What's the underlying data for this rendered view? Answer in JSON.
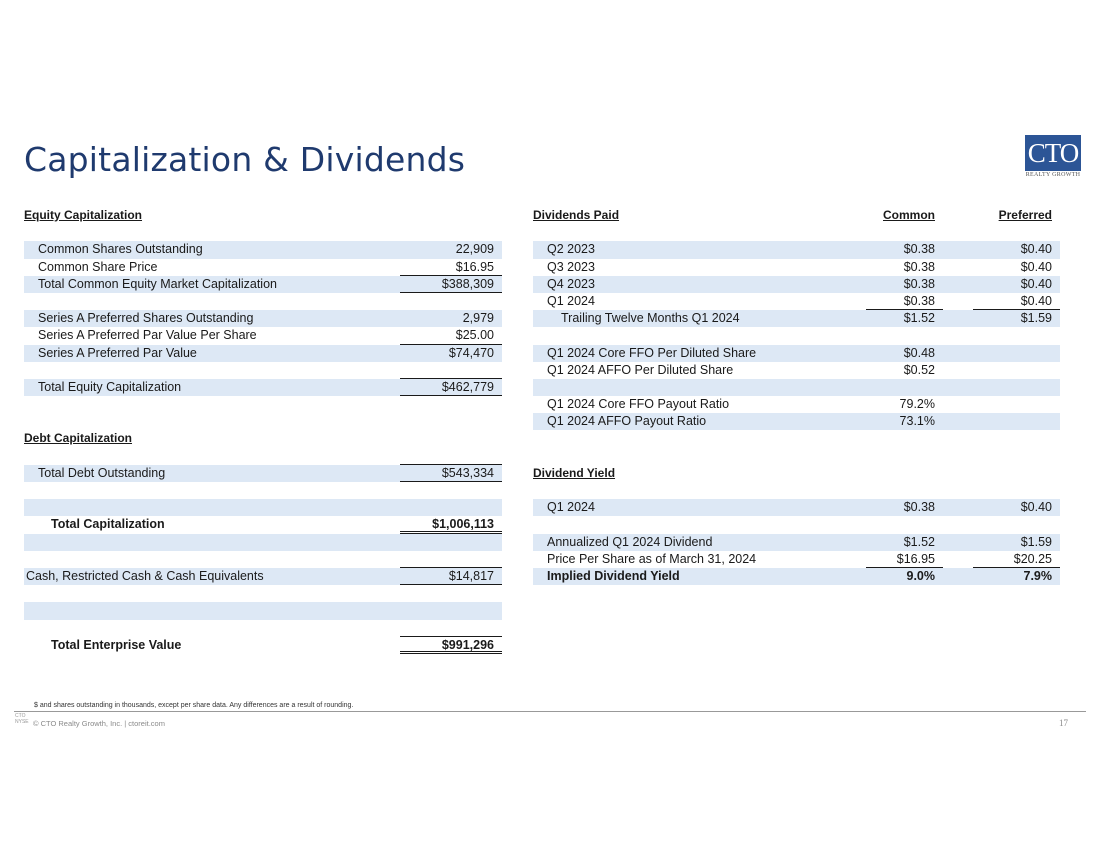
{
  "title": "Capitalization & Dividends",
  "logo": {
    "main": "CTO",
    "sub": "REALTY GROWTH"
  },
  "equity": {
    "header": "Equity Capitalization",
    "rows": [
      {
        "label": "Common Shares Outstanding",
        "value": "22,909"
      },
      {
        "label": "Common Share Price",
        "value": "$16.95"
      },
      {
        "label": "Total Common Equity Market Capitalization",
        "value": "$388,309"
      },
      {
        "label": "Series A Preferred Shares Outstanding",
        "value": "2,979"
      },
      {
        "label": "Series A Preferred Par Value Per Share",
        "value": "$25.00"
      },
      {
        "label": "Series A Preferred Par Value",
        "value": "$74,470"
      },
      {
        "label": "Total Equity Capitalization",
        "value": "$462,779"
      }
    ]
  },
  "debt": {
    "header": "Debt Capitalization",
    "total_debt": {
      "label": "Total Debt Outstanding",
      "value": "$543,334"
    },
    "total_cap": {
      "label": "Total Capitalization",
      "value": "$1,006,113"
    },
    "cash": {
      "label": "Cash, Restricted Cash & Cash Equivalents",
      "value": "$14,817"
    },
    "tev": {
      "label": "Total Enterprise Value",
      "value": "$991,296"
    }
  },
  "dividends": {
    "header": "Dividends Paid",
    "col_common": "Common",
    "col_preferred": "Preferred",
    "rows": [
      {
        "label": "Q2 2023",
        "common": "$0.38",
        "preferred": "$0.40"
      },
      {
        "label": "Q3 2023",
        "common": "$0.38",
        "preferred": "$0.40"
      },
      {
        "label": "Q4 2023",
        "common": "$0.38",
        "preferred": "$0.40"
      },
      {
        "label": "Q1 2024",
        "common": "$0.38",
        "preferred": "$0.40"
      },
      {
        "label": "Trailing Twelve Months Q1 2024",
        "common": "$1.52",
        "preferred": "$1.59"
      }
    ],
    "ffo": [
      {
        "label": "Q1 2024 Core FFO Per Diluted Share",
        "common": "$0.48"
      },
      {
        "label": "Q1 2024 AFFO Per Diluted Share",
        "common": "$0.52"
      }
    ],
    "payout": [
      {
        "label": "Q1 2024 Core FFO Payout Ratio",
        "common": "79.2%"
      },
      {
        "label": "Q1 2024 AFFO Payout Ratio",
        "common": "73.1%"
      }
    ]
  },
  "yield": {
    "header": "Dividend Yield",
    "q1": {
      "label": "Q1 2024",
      "common": "$0.38",
      "preferred": "$0.40"
    },
    "annualized": {
      "label": "Annualized Q1 2024 Dividend",
      "common": "$1.52",
      "preferred": "$1.59"
    },
    "price": {
      "label": "Price Per Share as of March 31, 2024",
      "common": "$16.95",
      "preferred": "$20.25"
    },
    "implied": {
      "label": "Implied Dividend Yield",
      "common": "9.0%",
      "preferred": "7.9%"
    }
  },
  "footnote": "$ and shares outstanding in thousands, except per share data. Any differences are a result of rounding.",
  "footer": {
    "logo_text": "CTO NYSE",
    "copyright": "© CTO Realty Growth, Inc. | ctoreit.com",
    "page": "17"
  }
}
